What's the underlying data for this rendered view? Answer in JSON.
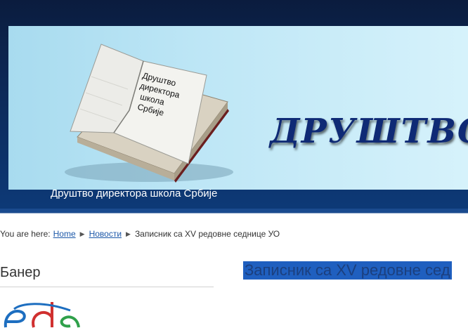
{
  "header": {
    "banner_title": "ДРУШТВО ДИР",
    "book_text": [
      "Друштво",
      "директора",
      "школа",
      "Србије"
    ],
    "site_name": "Друштво директора школа Србије",
    "colors": {
      "band": "#0c2a5a",
      "banner": "#bfe7f6",
      "title": "#0f2a75"
    }
  },
  "breadcrumb": {
    "prefix": "You are here:",
    "items": [
      "Home",
      "Новости"
    ],
    "current": "Записник са XV редовне седнице УО"
  },
  "sidebar": {
    "module_title": "Банер"
  },
  "article": {
    "title": "Записник са XV редовне сед"
  }
}
